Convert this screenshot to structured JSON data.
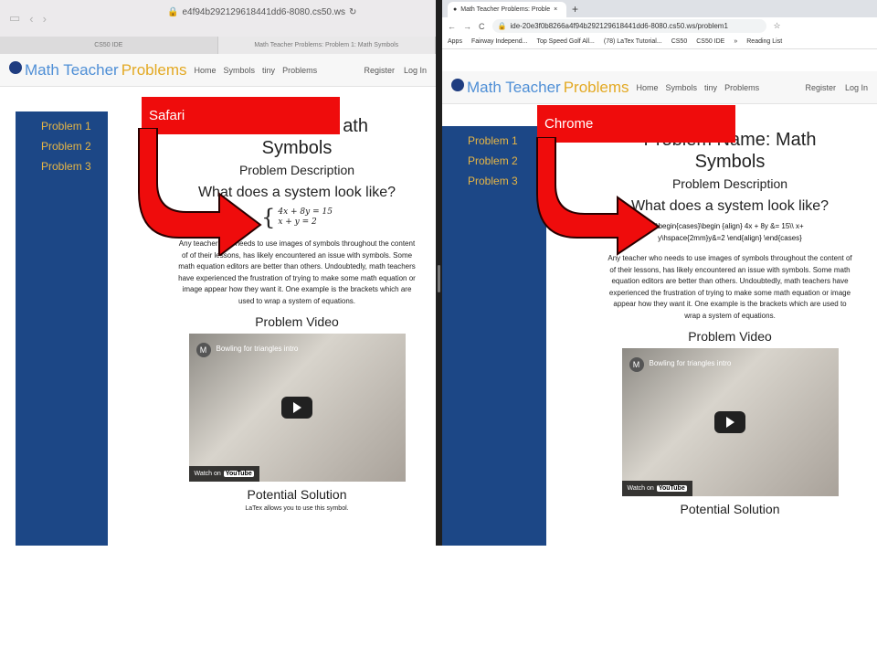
{
  "safari": {
    "url": "e4f94b292129618441dd6-8080.cs50.ws",
    "tabs": [
      "CS50 IDE",
      "Math Teacher Problems: Problem 1: Math Symbols"
    ],
    "label": "Safari"
  },
  "chrome": {
    "tab_title": "Math Teacher Problems: Proble",
    "url": "ide-20e3f0b8266a4f94b292129618441dd6-8080.cs50.ws/problem1",
    "bookmarks": [
      "Apps",
      "Fairway Independ...",
      "Top Speed Golf All...",
      "(78) LaTex Tutorial...",
      "CS50",
      "CS50 IDE",
      "»",
      "Reading List"
    ],
    "label": "Chrome"
  },
  "site": {
    "logo_a": "Math Teacher",
    "logo_b": "Problems",
    "nav": [
      "Home",
      "Symbols",
      "tiny",
      "Problems"
    ],
    "register": "Register",
    "login": "Log In",
    "sidebar": [
      "Problem 1",
      "Problem 2",
      "Problem 3"
    ],
    "problem_title": "Problem Name: Math Symbols",
    "safari_title_tail": "ath",
    "title_line2": "Symbols",
    "chrome_title_line1": "Problem Name: Math",
    "description_heading": "Problem Description",
    "question": "What does a system look like?",
    "eq1": "4x + 8y   = 15",
    "eq2": "x + y      = 2",
    "raw_latex_1": "\\begin{cases}\\begin {align} 4x + 8y &= 15\\\\ x+",
    "raw_latex_2": "y\\hspace{2mm}y&=2 \\end{align} \\end{cases}",
    "paragraph": "Any teacher who needs to use images of symbols throughout the content of of their lessons, has likely encountered an issue with symbols. Some math equation editors are better than others. Undoubtedly, math teachers have experienced the frustration of trying to make some math equation or image appear how they want it. One example is the brackets which are used to wrap a system of equations.",
    "video_heading": "Problem Video",
    "video_title": "Bowling for triangles intro",
    "video_channel_letter": "M",
    "watch_on": "Watch on",
    "youtube": "YouTube",
    "solution_heading": "Potential Solution",
    "solution_text": "LaTex allows you to use this symbol."
  },
  "colors": {
    "label_red": "#ef0c0c",
    "sidebar_blue": "#1c4786",
    "sidebar_text": "#e6b545"
  }
}
